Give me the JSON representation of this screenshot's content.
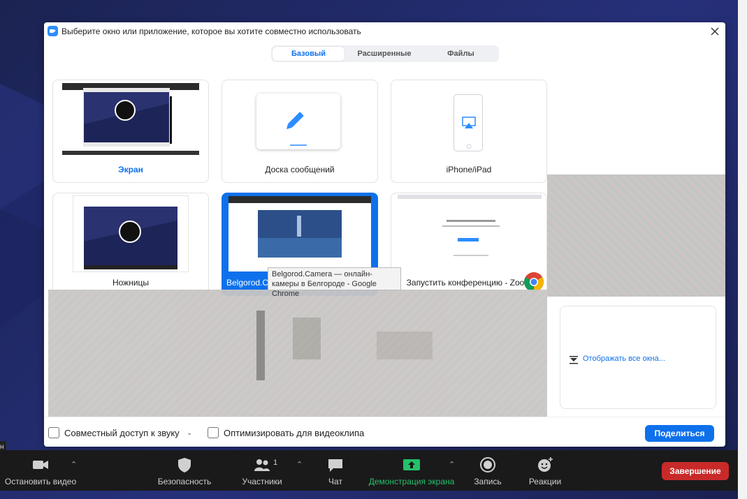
{
  "dialog": {
    "title": "Выберите окно или приложение, которое вы хотите совместно использовать",
    "tabs": [
      {
        "label": "Базовый",
        "active": true
      },
      {
        "label": "Расширенные",
        "active": false
      },
      {
        "label": "Файлы",
        "active": false
      }
    ],
    "tiles": [
      {
        "label": "Экран"
      },
      {
        "label": "Доска сообщений"
      },
      {
        "label": "iPhone/iPad"
      },
      {
        "label": "Ножницы"
      },
      {
        "label": "Belgorod.Camera — онлайн-камеры в Белгороде - Google Chrome"
      },
      {
        "label": "Запустить конференцию - Zoo..."
      }
    ],
    "tooltip": "Belgorod.Camera — онлайн-камеры в Белгороде - Google Chrome",
    "show_all": "Отображать все окна...",
    "footer": {
      "share_audio": "Совместный доступ к звуку",
      "optimize_video": "Оптимизировать для видеоклипа",
      "share_button": "Поделиться"
    }
  },
  "toolbar": {
    "side_tag": "н",
    "items": [
      {
        "label": "Остановить видео"
      },
      {
        "label": "Безопасность"
      },
      {
        "label": "Участники",
        "count": "1"
      },
      {
        "label": "Чат"
      },
      {
        "label": "Демонстрация экрана"
      },
      {
        "label": "Запись"
      },
      {
        "label": "Реакции"
      }
    ],
    "end_button": "Завершение"
  },
  "colors": {
    "accent": "#0e71eb",
    "share_green": "#24c16a",
    "end_red": "#c82a2a"
  }
}
